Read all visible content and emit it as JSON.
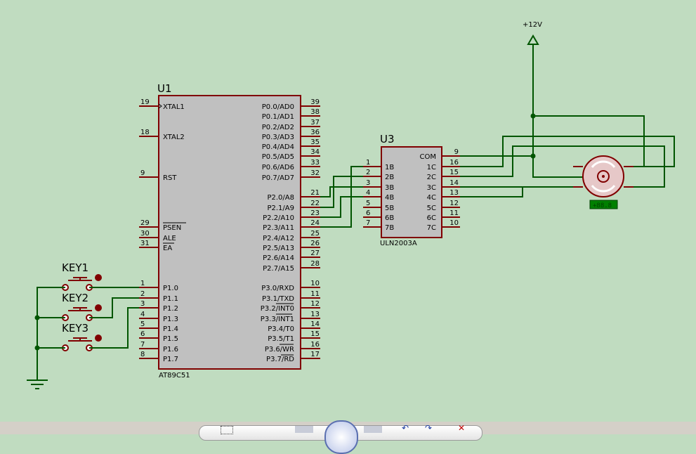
{
  "colors": {
    "background": "#c0dcc0",
    "wire": "#005500",
    "component_outline": "#800000",
    "component_fill": "#c0c0c0",
    "motor_label_bg": "#008000"
  },
  "mcu": {
    "ref": "U1",
    "part": "AT89C51",
    "left_pins": [
      {
        "num": "19",
        "name": "XTAL1"
      },
      {
        "num": "18",
        "name": "XTAL2"
      },
      {
        "num": "9",
        "name": "RST"
      },
      {
        "num": "29",
        "name": "PSEN"
      },
      {
        "num": "30",
        "name": "ALE"
      },
      {
        "num": "31",
        "name": "EA"
      },
      {
        "num": "1",
        "name": "P1.0"
      },
      {
        "num": "2",
        "name": "P1.1"
      },
      {
        "num": "3",
        "name": "P1.2"
      },
      {
        "num": "4",
        "name": "P1.3"
      },
      {
        "num": "5",
        "name": "P1.4"
      },
      {
        "num": "6",
        "name": "P1.5"
      },
      {
        "num": "7",
        "name": "P1.6"
      },
      {
        "num": "8",
        "name": "P1.7"
      }
    ],
    "right_pins": [
      {
        "num": "39",
        "name": "P0.0/AD0"
      },
      {
        "num": "38",
        "name": "P0.1/AD1"
      },
      {
        "num": "37",
        "name": "P0.2/AD2"
      },
      {
        "num": "36",
        "name": "P0.3/AD3"
      },
      {
        "num": "35",
        "name": "P0.4/AD4"
      },
      {
        "num": "34",
        "name": "P0.5/AD5"
      },
      {
        "num": "33",
        "name": "P0.6/AD6"
      },
      {
        "num": "32",
        "name": "P0.7/AD7"
      },
      {
        "num": "21",
        "name": "P2.0/A8"
      },
      {
        "num": "22",
        "name": "P2.1/A9"
      },
      {
        "num": "23",
        "name": "P2.2/A10"
      },
      {
        "num": "24",
        "name": "P2.3/A11"
      },
      {
        "num": "25",
        "name": "P2.4/A12"
      },
      {
        "num": "26",
        "name": "P2.5/A13"
      },
      {
        "num": "27",
        "name": "P2.6/A14"
      },
      {
        "num": "28",
        "name": "P2.7/A15"
      },
      {
        "num": "10",
        "name": "P3.0/RXD"
      },
      {
        "num": "11",
        "name": "P3.1/TXD"
      },
      {
        "num": "12",
        "name": "P3.2/INT0"
      },
      {
        "num": "13",
        "name": "P3.3/INT1"
      },
      {
        "num": "14",
        "name": "P3.4/T0"
      },
      {
        "num": "15",
        "name": "P3.5/T1"
      },
      {
        "num": "16",
        "name": "P3.6/WR"
      },
      {
        "num": "17",
        "name": "P3.7/RD"
      }
    ]
  },
  "driver": {
    "ref": "U3",
    "part": "ULN2003A",
    "left_pins": [
      {
        "num": "1",
        "name": "1B"
      },
      {
        "num": "2",
        "name": "2B"
      },
      {
        "num": "3",
        "name": "3B"
      },
      {
        "num": "4",
        "name": "4B"
      },
      {
        "num": "5",
        "name": "5B"
      },
      {
        "num": "6",
        "name": "6B"
      },
      {
        "num": "7",
        "name": "7B"
      }
    ],
    "right_pins": [
      {
        "num": "9",
        "name": "COM"
      },
      {
        "num": "16",
        "name": "1C"
      },
      {
        "num": "15",
        "name": "2C"
      },
      {
        "num": "14",
        "name": "3C"
      },
      {
        "num": "13",
        "name": "4C"
      },
      {
        "num": "12",
        "name": "5C"
      },
      {
        "num": "11",
        "name": "6C"
      },
      {
        "num": "10",
        "name": "7C"
      }
    ]
  },
  "keys": [
    "KEY1",
    "KEY2",
    "KEY3"
  ],
  "power": {
    "label": "+12V"
  },
  "motor": {
    "label": "+88.8"
  }
}
